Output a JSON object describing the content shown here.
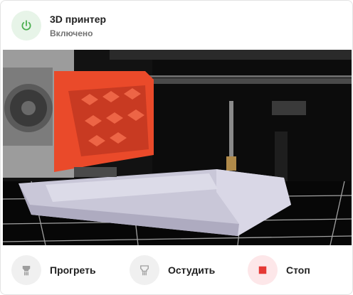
{
  "device": {
    "title": "3D принтер",
    "state": "Включено",
    "power_icon": "power-icon",
    "power_color": "#4caf50"
  },
  "camera": {
    "description_icon": "camera-feed"
  },
  "actions": [
    {
      "label": "Прогреть",
      "icon": "heat-icon",
      "color": "#9e9e9e"
    },
    {
      "label": "Остудить",
      "icon": "cool-icon",
      "color": "#9e9e9e"
    },
    {
      "label": "Стоп",
      "icon": "stop-icon",
      "color": "#e53935"
    }
  ]
}
